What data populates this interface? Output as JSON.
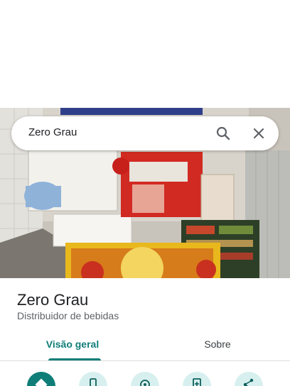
{
  "search": {
    "query": "Zero Grau"
  },
  "place": {
    "name": "Zero Grau",
    "category": "Distribuidor de bebidas"
  },
  "tabs": [
    {
      "label": "Visão geral",
      "active": true
    },
    {
      "label": "Sobre",
      "active": false
    }
  ],
  "actions": [
    {
      "icon": "directions-icon"
    },
    {
      "icon": "phone-icon"
    },
    {
      "icon": "location-icon"
    },
    {
      "icon": "save-icon"
    },
    {
      "icon": "share-icon"
    }
  ],
  "colors": {
    "accent": "#0f7d78",
    "accent_light": "#d7f0ef"
  }
}
